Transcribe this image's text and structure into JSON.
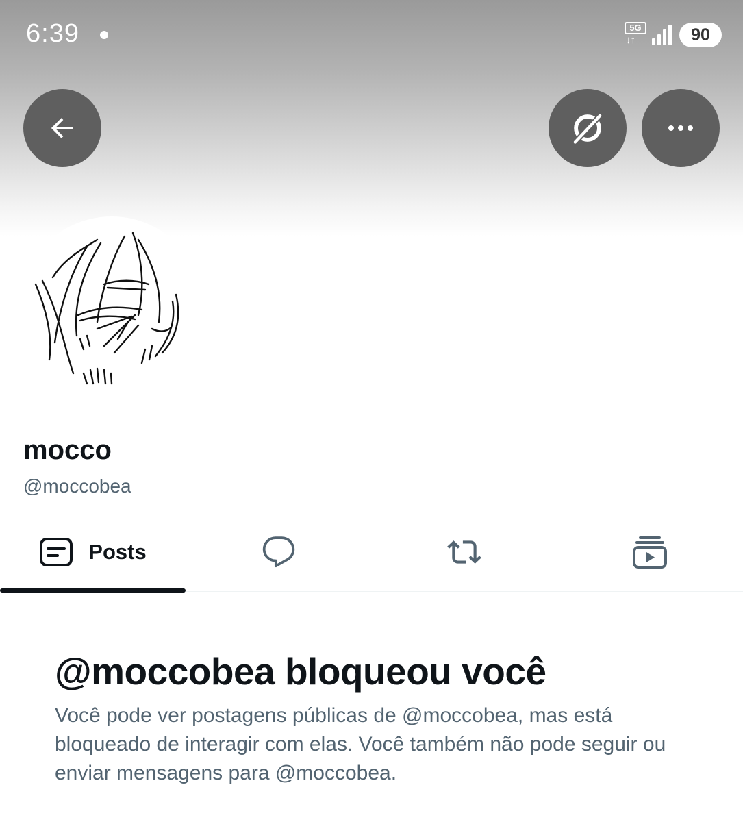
{
  "status_bar": {
    "time": "6:39",
    "network": "5G",
    "battery": "90"
  },
  "header": {
    "back_icon": "arrow-left-icon",
    "grok_icon": "grok-icon",
    "more_icon": "more-horizontal-icon"
  },
  "profile": {
    "display_name": "mocco",
    "handle": "@moccobea",
    "avatar_icon": "sketch-face-avatar"
  },
  "tabs": [
    {
      "label": "Posts",
      "icon": "posts-icon",
      "active": true
    },
    {
      "label": "",
      "icon": "reply-bubble-icon",
      "active": false
    },
    {
      "label": "",
      "icon": "repost-icon",
      "active": false
    },
    {
      "label": "",
      "icon": "media-play-icon",
      "active": false
    }
  ],
  "blocked": {
    "title": "@moccobea bloqueou você",
    "description": "Você pode ver postagens públicas de @moccobea, mas está bloqueado de interagir com elas. Você também não pode seguir ou enviar mensagens para @moccobea."
  },
  "colors": {
    "text_primary": "#0f1419",
    "text_secondary": "#536471",
    "header_button": "#5f5f5f"
  }
}
